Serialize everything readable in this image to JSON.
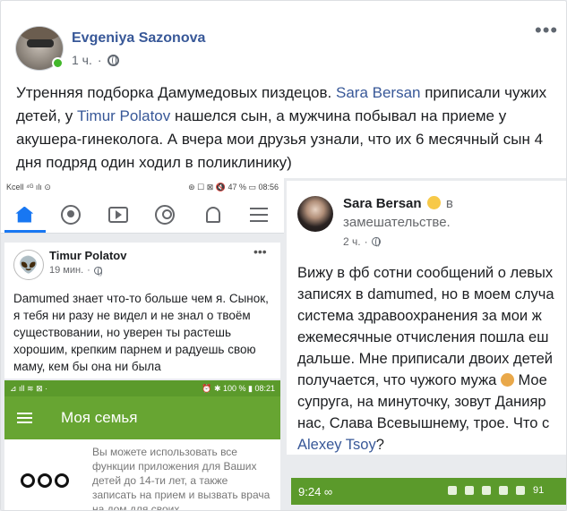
{
  "post": {
    "author": "Evgeniya Sazonova",
    "time": "1 ч.",
    "more": "•••",
    "text_parts": [
      "Утренняя подборка Дамумедовых пиздецов. ",
      "Sara Bersan",
      " приписали чужих детей, у ",
      "Timur Polatov",
      " нашелся сын, а мужчина побывал на приеме у акушера-гинеколога. А вчера мои друзья узнали, что их 6 месячный сын 4 дня подряд один ходил в поликлинику)"
    ]
  },
  "left_screenshot": {
    "status_bar": {
      "left": "Kcell ⁴ᴳ ılı ⊙",
      "right": "⊛ ☐ ⊠ 🔇 47 % ▭ 08:56"
    },
    "inner_post": {
      "author": "Timur Polatov",
      "time": "19 мин.",
      "more": "•••",
      "text": "Damumed знает что-то больше чем я. Сынок, я тебя ни разу не видел и не знал о твоём существовании, но уверен ты растешь хорошим, крепким парнем и радуешь свою маму, кем бы она ни была"
    },
    "app_status_bar": {
      "left": "⊿ ıll ≋ ⊠ ·",
      "right": "⏰ ✱ 100 % ▮ 08:21"
    },
    "app_header_title": "Моя семья",
    "app_text": "Вы можете использовать все функции приложения для Ваших детей до 14-ти лет, а также записать на прием и вызвать врача на дом для своих"
  },
  "right_screenshot": {
    "author": "Sara Bersan",
    "feeling_prefix": "в",
    "feeling": "замешательстве.",
    "time": "2 ч.",
    "text_lines": [
      "Вижу в фб сотни сообщений о левых",
      "записях в damumed, но в моем случа",
      "система здравоохранения за мои ж",
      "ежемесячные отчисления пошла еш",
      "дальше. Мне приписали двоих детей",
      "получается, что чужого мужа",
      " Мое",
      "супруга, на минуточку, зовут Данияр",
      "нас, Слава Всевышнему, трое. Что с",
      "Alexey Tsoy",
      "?"
    ],
    "status_bar": {
      "time": "9:24 ∞",
      "battery": "91"
    }
  }
}
